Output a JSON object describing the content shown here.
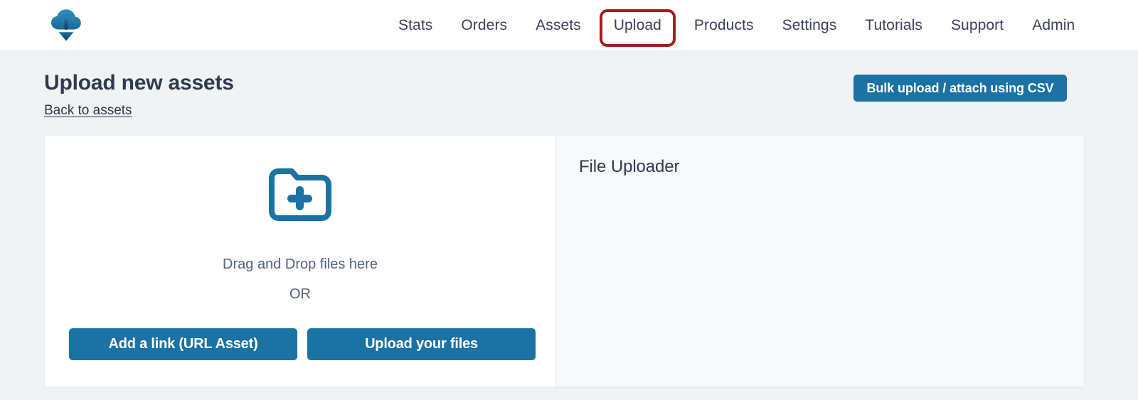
{
  "header": {
    "logo_icon": "cloud-download-icon",
    "nav_items": [
      {
        "label": "Stats",
        "highlighted": false
      },
      {
        "label": "Orders",
        "highlighted": false
      },
      {
        "label": "Assets",
        "highlighted": false
      },
      {
        "label": "Upload",
        "highlighted": true
      },
      {
        "label": "Products",
        "highlighted": false
      },
      {
        "label": "Settings",
        "highlighted": false
      },
      {
        "label": "Tutorials",
        "highlighted": false
      },
      {
        "label": "Support",
        "highlighted": false
      },
      {
        "label": "Admin",
        "highlighted": false
      }
    ]
  },
  "page": {
    "title": "Upload new assets",
    "back_link": "Back to assets",
    "csv_button": "Bulk upload / attach using CSV"
  },
  "drop_zone": {
    "folder_icon": "folder-plus-icon",
    "drag_text": "Drag and Drop files here",
    "or_text": "OR",
    "add_link_button": "Add a link (URL Asset)",
    "upload_files_button": "Upload your files"
  },
  "uploader_panel": {
    "title": "File Uploader"
  },
  "colors": {
    "page_background": "#f1f2f4",
    "header_background": "#ffffff",
    "accent_blue": "#1b72a4",
    "highlight_red": "#a51c1c",
    "text_dark": "#2e3a4e",
    "text_muted": "#55607a",
    "panel_gray": "#f8f9fb"
  }
}
